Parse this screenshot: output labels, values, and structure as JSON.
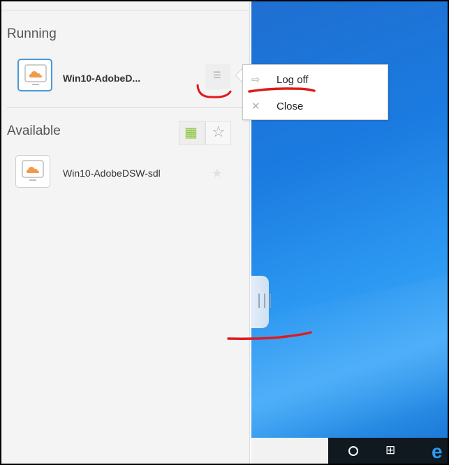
{
  "running": {
    "title": "Running",
    "app": {
      "name": "Win10-AdobeD...",
      "icon": "desktop-cloud-icon"
    }
  },
  "available": {
    "title": "Available",
    "app": {
      "name": "Win10-AdobeDSW-sdl",
      "icon": "desktop-cloud-icon"
    }
  },
  "toolbar": {
    "grid_icon": "grid-view-icon",
    "star_icon": "favorites-star-icon"
  },
  "context_menu": {
    "items": [
      {
        "label": "Log off",
        "icon": "logoff-icon"
      },
      {
        "label": "Close",
        "icon": "close-icon"
      }
    ]
  },
  "colors": {
    "accent_blue": "#4a9ad8",
    "cloud_orange": "#f39a4a",
    "grid_green": "#8cc63f",
    "annotation_red": "#e01b1b",
    "desktop_blue": "#1b7be0"
  },
  "taskbar": {
    "icons": [
      "cortana-search-icon",
      "task-view-icon",
      "edge-browser-icon"
    ]
  }
}
